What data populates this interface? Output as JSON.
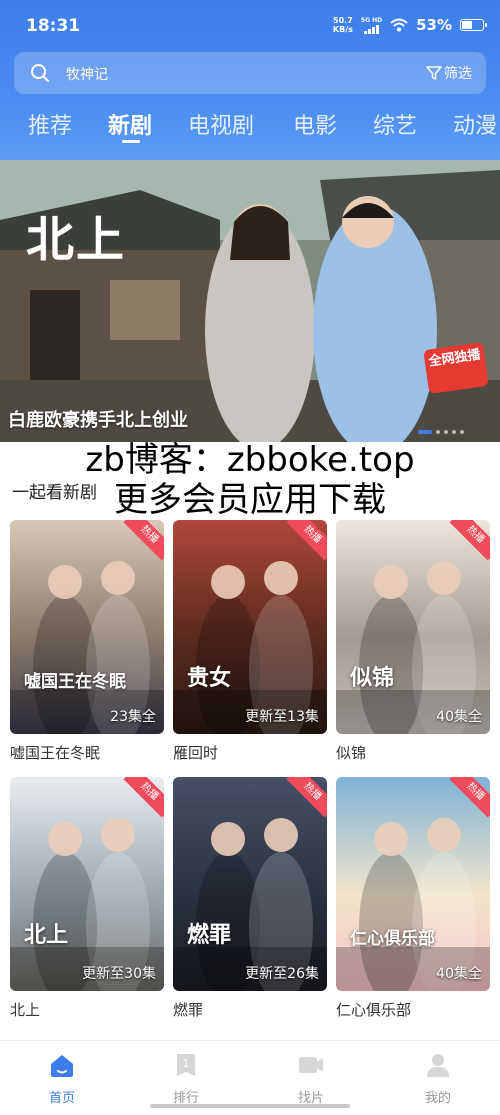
{
  "status_bar": {
    "time": "18:31",
    "net_speed": "50.7",
    "net_unit": "KB/s",
    "signal_label": "5G HD",
    "battery_percent": "53%",
    "battery_level": 0.53
  },
  "search": {
    "placeholder": "牧神记",
    "filter_label": "筛选"
  },
  "tabs": [
    {
      "label": "推荐",
      "active": false
    },
    {
      "label": "新剧",
      "active": true
    },
    {
      "label": "电视剧",
      "active": false
    },
    {
      "label": "电影",
      "active": false
    },
    {
      "label": "综艺",
      "active": false
    },
    {
      "label": "动漫",
      "active": false
    }
  ],
  "banner": {
    "calligraphy": "北上",
    "title": "白鹿欧豪携手北上创业",
    "badge": "全网独播",
    "dot_count": 5,
    "active_dot": 0
  },
  "watermark": {
    "line1": "zb博客：zbboke.top",
    "line2": "更多会员应用下载"
  },
  "section": {
    "title": "一起看新剧"
  },
  "cards": [
    {
      "title": "嘘国王在冬眠",
      "episode": "23集全",
      "poster_text": "嘘国王在冬眠",
      "hot": "热播",
      "colors": [
        "#3a3a4a",
        "#8b7a6a",
        "#d9c7b8"
      ]
    },
    {
      "title": "雁回时",
      "episode": "更新至13集",
      "poster_text": "贵女",
      "hot": "热播",
      "colors": [
        "#2a1a14",
        "#5a2a1e",
        "#b0473a"
      ]
    },
    {
      "title": "似锦",
      "episode": "40集全",
      "poster_text": "似锦",
      "hot": "热播",
      "colors": [
        "#c9c2bd",
        "#a49a90",
        "#efe6db"
      ]
    },
    {
      "title": "北上",
      "episode": "更新至30集",
      "poster_text": "北上",
      "hot": "热播",
      "colors": [
        "#6c6a63",
        "#9aa7b1",
        "#e9ecef"
      ]
    },
    {
      "title": "燃罪",
      "episode": "更新至26集",
      "poster_text": "燃罪",
      "hot": "热播",
      "colors": [
        "#1a1d24",
        "#2b3140",
        "#475066"
      ]
    },
    {
      "title": "仁心俱乐部",
      "episode": "40集全",
      "poster_text": "仁心俱乐部",
      "hot": "热播",
      "colors": [
        "#f7c2c8",
        "#f2e4c9",
        "#7fb3d8"
      ]
    }
  ],
  "bottom_nav": [
    {
      "label": "首页",
      "icon": "home-icon",
      "active": true
    },
    {
      "label": "排行",
      "icon": "ranking-icon",
      "active": false
    },
    {
      "label": "找片",
      "icon": "video-icon",
      "active": false
    },
    {
      "label": "我的",
      "icon": "profile-icon",
      "active": false
    }
  ],
  "colors": {
    "primary": "#3d7dea",
    "hot_badge": "#ef4b5c",
    "exclusive_badge": "#e43a32"
  }
}
